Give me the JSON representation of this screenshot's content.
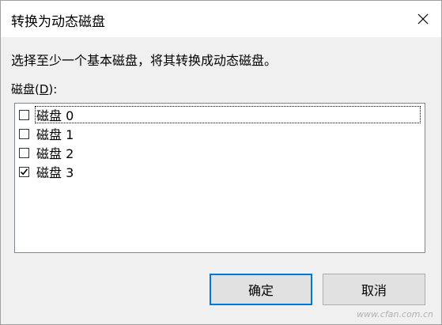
{
  "window": {
    "title": "转换为动态磁盘",
    "close_icon": "close-icon"
  },
  "instruction": "选择至少一个基本磁盘，将其转换成动态磁盘。",
  "disk_list": {
    "label_prefix": "磁盘(",
    "label_accel": "D",
    "label_suffix": "):",
    "items": [
      {
        "label": "磁盘 0",
        "checked": false
      },
      {
        "label": "磁盘 1",
        "checked": false
      },
      {
        "label": "磁盘 2",
        "checked": false
      },
      {
        "label": "磁盘 3",
        "checked": true
      }
    ]
  },
  "buttons": {
    "ok_label": "确定",
    "cancel_label": "取消"
  },
  "watermark": "www.cfan.com.cn",
  "colors": {
    "accent": "#0078d7",
    "dialog_bg": "#f0f0f0",
    "list_border": "#828790"
  }
}
